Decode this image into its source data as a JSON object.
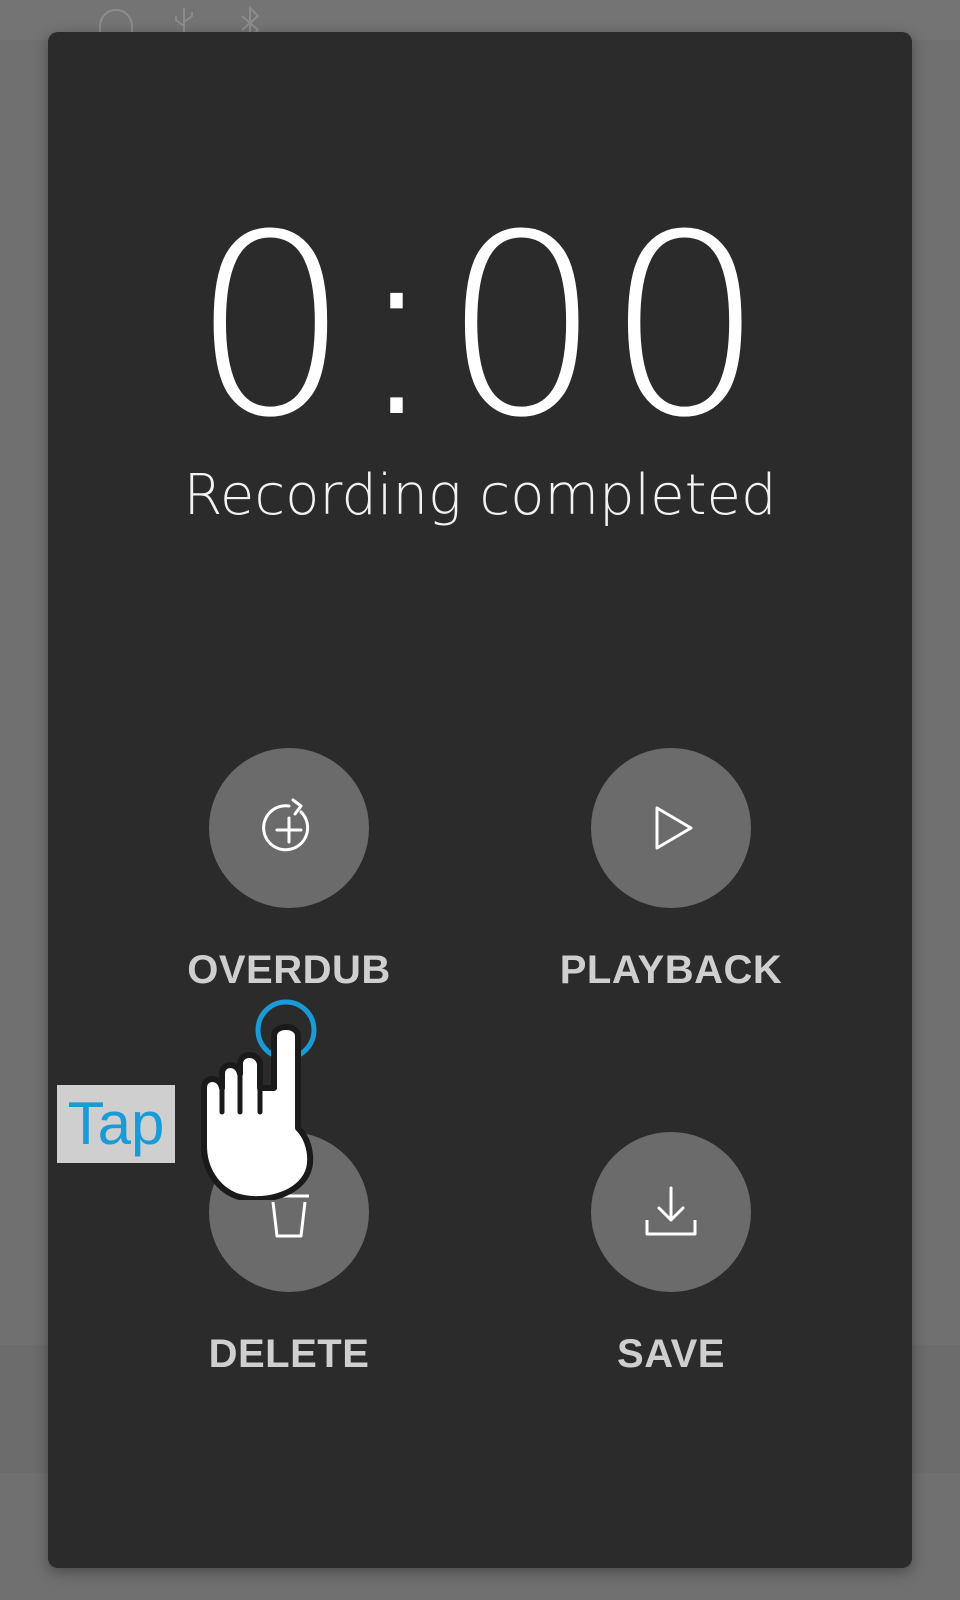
{
  "status_bar": {
    "icons": [
      "headphones-icon",
      "usb-icon",
      "bluetooth-icon"
    ]
  },
  "dialog": {
    "timer": "0:00",
    "status": "Recording completed",
    "actions": [
      {
        "label": "OVERDUB",
        "icon": "overdub-icon"
      },
      {
        "label": "PLAYBACK",
        "icon": "play-icon"
      },
      {
        "label": "DELETE",
        "icon": "trash-icon"
      },
      {
        "label": "SAVE",
        "icon": "save-download-icon"
      }
    ]
  },
  "tutorial": {
    "gesture_label": "Tap",
    "gesture_icon": "tap-hand-icon"
  },
  "colors": {
    "modal_background": "#2b2b2b",
    "button_circle": "#6b6b6b",
    "label": "#cfcfcf",
    "tap_accent": "#1a9ad6"
  }
}
